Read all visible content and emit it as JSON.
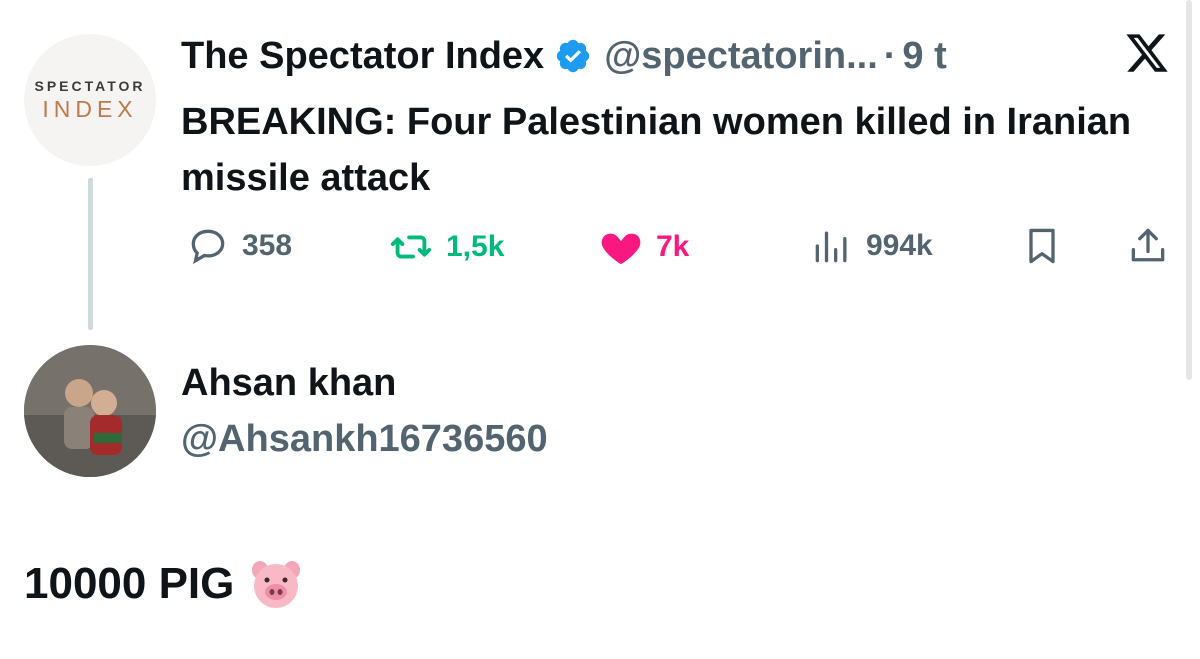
{
  "tweet": {
    "logo_top": "SPECTATOR",
    "logo_bottom": "INDEX",
    "author_name": "The Spectator Index",
    "verified_icon": "verified-badge-icon",
    "handle": "@spectatorin...",
    "separator": "·",
    "time": "9 t",
    "text": "BREAKING: Four Palestinian women killed in Iranian missile attack",
    "stats": {
      "replies": "358",
      "retweets": "1,5k",
      "likes": "7k",
      "views": "994k"
    },
    "icons": [
      "reply-icon",
      "retweet-icon",
      "heart-icon",
      "views-icon",
      "bookmark-icon",
      "share-icon"
    ]
  },
  "reply": {
    "name": "Ahsan khan",
    "handle": "@Ahsankh16736560",
    "text": "10000 PIG",
    "emoji_icon": "pig-face-icon"
  },
  "colors": {
    "text": "#0f1419",
    "secondary": "#536471",
    "retweet": "#00ba7c",
    "like": "#f91880",
    "verified": "#1d9bf0",
    "logo_accent": "#c0794d"
  }
}
